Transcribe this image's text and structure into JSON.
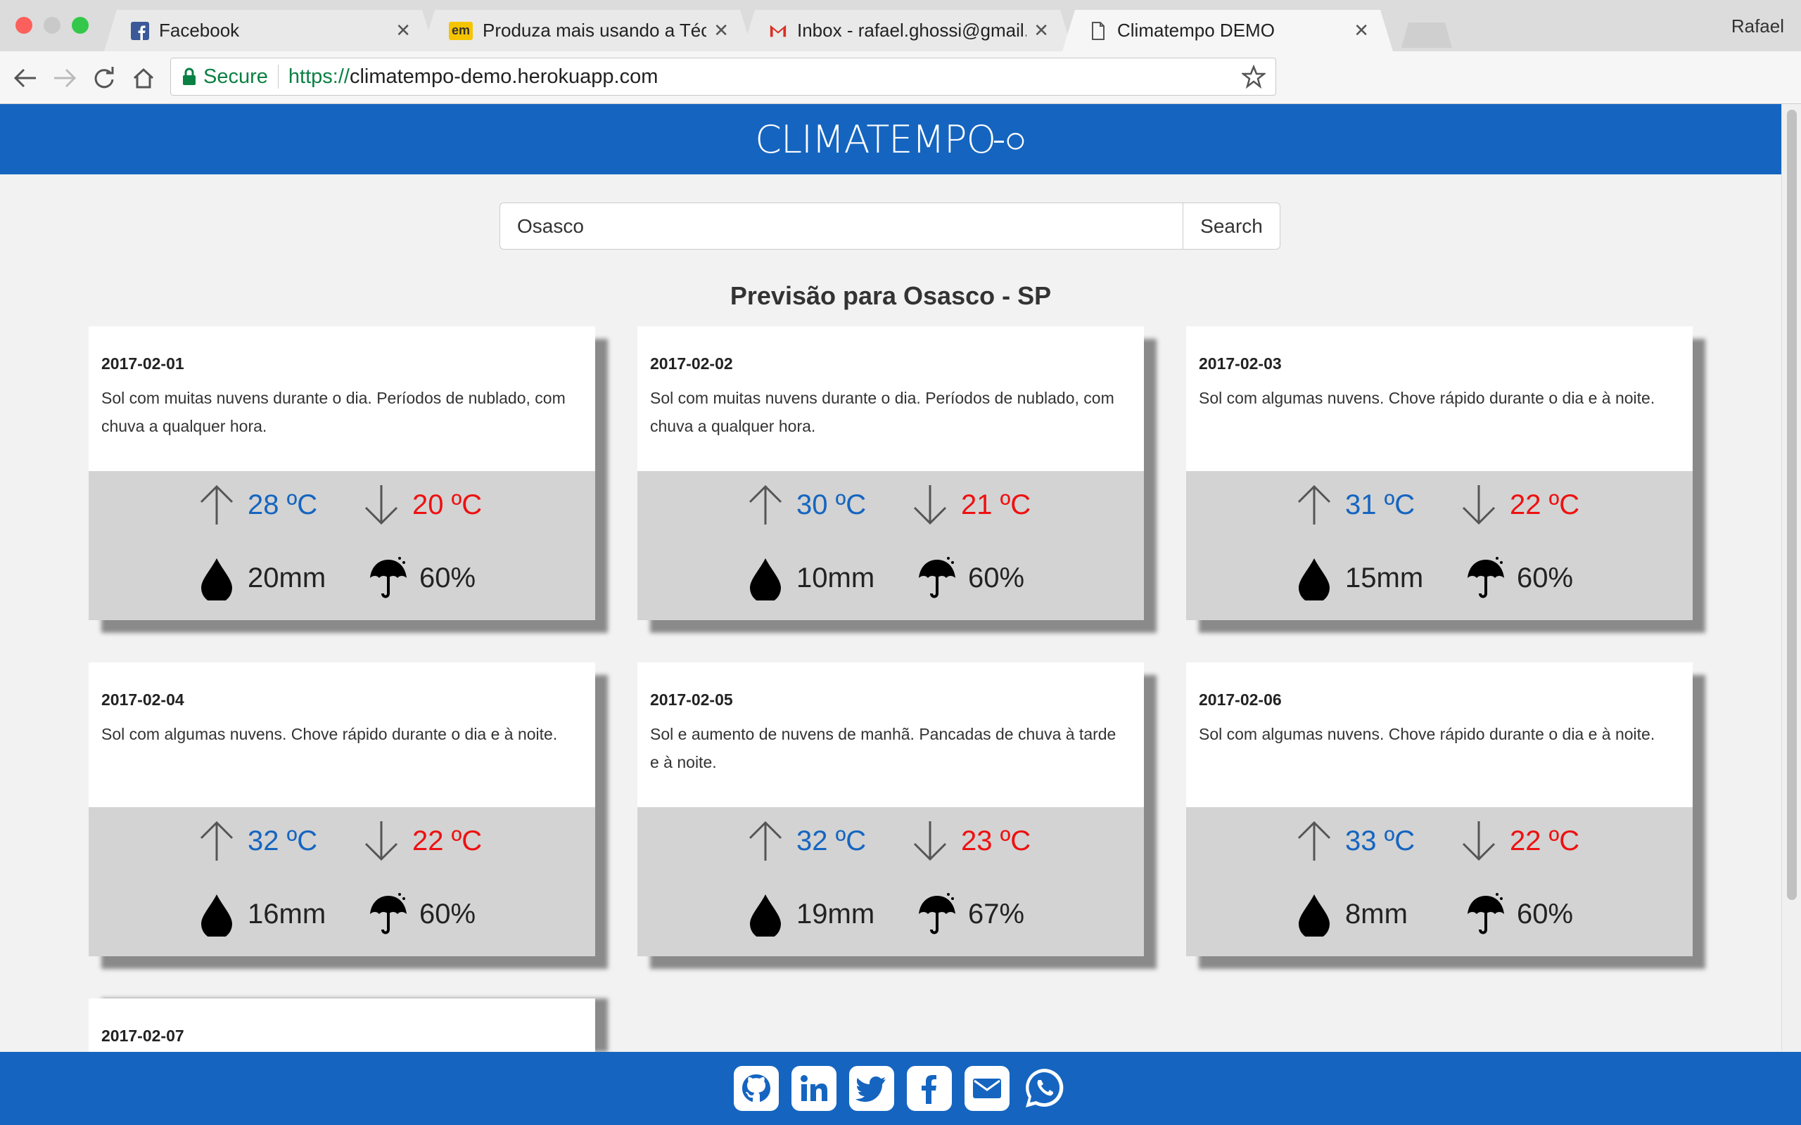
{
  "browser": {
    "tabs": [
      {
        "title": "Facebook",
        "icon": "facebook-favicon"
      },
      {
        "title": "Produza mais usando a Técnica",
        "icon": "em-favicon"
      },
      {
        "title": "Inbox - rafael.ghossi@gmail.com",
        "icon": "gmail-favicon"
      },
      {
        "title": "Climatempo DEMO",
        "icon": "page-favicon",
        "active": true
      }
    ],
    "profile_name": "Rafael",
    "secure_label": "Secure",
    "url_scheme": "https://",
    "url_host": "climatempo-demo.herokuapp.com"
  },
  "app": {
    "brand": "CLIMATEMPO",
    "accent_color": "#1565c0",
    "search": {
      "value": "Osasco",
      "button_label": "Search"
    },
    "forecast_title": "Previsão para Osasco - SP"
  },
  "forecast": [
    {
      "date": "2017-02-01",
      "text": "Sol com muitas nuvens durante o dia. Períodos de nublado, com chuva a qualquer hora.",
      "max": "28 ºC",
      "min": "20 ºC",
      "rain": "20mm",
      "prob": "60%"
    },
    {
      "date": "2017-02-02",
      "text": "Sol com muitas nuvens durante o dia. Períodos de nublado, com chuva a qualquer hora.",
      "max": "30 ºC",
      "min": "21 ºC",
      "rain": "10mm",
      "prob": "60%"
    },
    {
      "date": "2017-02-03",
      "text": "Sol com algumas nuvens. Chove rápido durante o dia e à noite.",
      "max": "31 ºC",
      "min": "22 ºC",
      "rain": "15mm",
      "prob": "60%"
    },
    {
      "date": "2017-02-04",
      "text": "Sol com algumas nuvens. Chove rápido durante o dia e à noite.",
      "max": "32 ºC",
      "min": "22 ºC",
      "rain": "16mm",
      "prob": "60%"
    },
    {
      "date": "2017-02-05",
      "text": "Sol e aumento de nuvens de manhã. Pancadas de chuva à tarde e à noite.",
      "max": "32 ºC",
      "min": "23 ºC",
      "rain": "19mm",
      "prob": "67%"
    },
    {
      "date": "2017-02-06",
      "text": "Sol com algumas nuvens. Chove rápido durante o dia e à noite.",
      "max": "33 ºC",
      "min": "22 ºC",
      "rain": "8mm",
      "prob": "60%"
    },
    {
      "date": "2017-02-07"
    }
  ],
  "footer": {
    "icons": [
      "github-icon",
      "linkedin-icon",
      "twitter-icon",
      "facebook-icon",
      "email-icon",
      "whatsapp-icon"
    ]
  }
}
